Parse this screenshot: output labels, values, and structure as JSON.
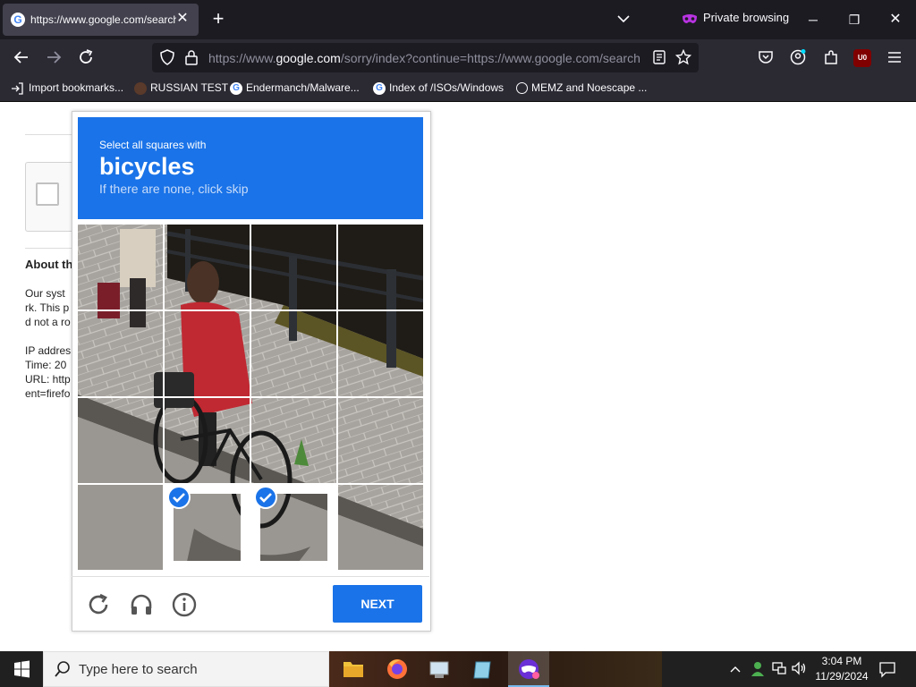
{
  "browser": {
    "tab_title": "https://www.google.com/search",
    "tab_favicon": "G",
    "private_label": "Private browsing",
    "url_prefix": "https://www.",
    "url_domain": "google.com",
    "url_rest": "/sorry/index?continue=https://www.google.com/search",
    "bookmarks": [
      {
        "label": "Import bookmarks..."
      },
      {
        "label": "RUSSIAN TEST"
      },
      {
        "label": "Endermanch/Malware..."
      },
      {
        "label": "Index of /ISOs/Windows"
      },
      {
        "label": "MEMZ and Noescape ..."
      }
    ],
    "ublock_badge": "U0"
  },
  "page": {
    "about_heading": "About th",
    "line1": "Our syst",
    "line2": "rk. This p",
    "line3": "d not a ro",
    "ip": "IP addres",
    "time": "Time: 20",
    "url": "URL: http",
    "ent": "ent=firefo"
  },
  "captcha": {
    "instruction": "Select all squares with",
    "target": "bicycles",
    "hint": "If there are none, click skip",
    "next_label": "NEXT",
    "selected_tiles": [
      13,
      14
    ]
  },
  "taskbar": {
    "search_placeholder": "Type here to search",
    "time": "3:04 PM",
    "date": "11/29/2024"
  },
  "colors": {
    "captcha_blue": "#1a73e8",
    "chrome_dark": "#1c1b22",
    "toolbar": "#2b2a33"
  }
}
